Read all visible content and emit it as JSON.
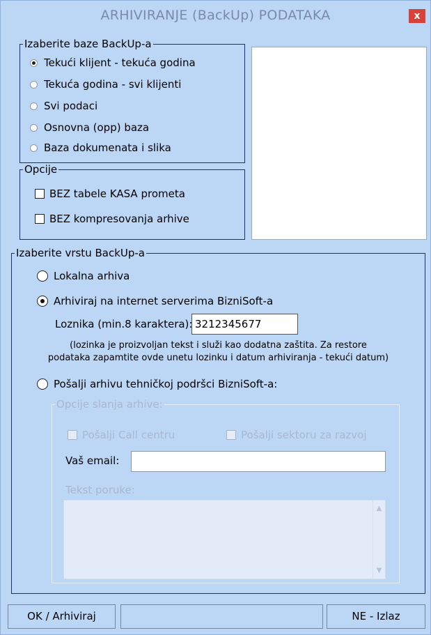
{
  "window": {
    "title": "ARHIVIRANJE (BackUp)  PODATAKA",
    "close_glyph": "x"
  },
  "baze": {
    "legend": "Izaberite baze BackUp-a",
    "options": [
      {
        "label": "Tekući klijent - tekuća godina",
        "selected": true
      },
      {
        "label": "Tekuća godina - svi klijenti",
        "selected": false
      },
      {
        "label": "Svi podaci",
        "selected": false
      },
      {
        "label": "Osnovna (opp) baza",
        "selected": false
      },
      {
        "label": "Baza dokumenata i slika",
        "selected": false
      }
    ]
  },
  "opcije": {
    "legend": "Opcije",
    "items": [
      {
        "label": "BEZ tabele KASA prometa",
        "checked": false
      },
      {
        "label": "BEZ kompresovanja arhive",
        "checked": false
      }
    ]
  },
  "vrsta": {
    "legend": "Izaberite vrstu BackUp-a",
    "lokalna": {
      "label": "Lokalna arhiva",
      "selected": false
    },
    "internet": {
      "label": "Arhiviraj na internet serverima BizniSoft-a",
      "selected": true
    },
    "password_label": "Loznika (min.8 karaktera):",
    "password_value": "3212345677",
    "note_line1": "(lozinka je proizvoljan tekst i služi kao dodatna zaštita. Za restore",
    "note_line2": "podataka zapamtite ovde unetu lozinku i datum arhiviranja - tekući datum)",
    "posalji": {
      "label": "Pošalji arhivu tehničkoj podršci BizniSoft-a:",
      "selected": false
    }
  },
  "slanje": {
    "legend": "Opcije slanja arhive:",
    "call_centar_label": "Pošalji Call centru",
    "razvoj_label": "Pošalji sektoru za razvoj",
    "email_label": "Vaš email:",
    "email_value": "",
    "message_label": "Tekst poruke:",
    "message_value": ""
  },
  "buttons": {
    "ok": "OK / Arhiviraj",
    "cancel": "NE - Izlaz"
  },
  "colors": {
    "window_bg": "#bcd6f5",
    "close_red": "#d9413b",
    "group_border": "#1e2f6e"
  }
}
